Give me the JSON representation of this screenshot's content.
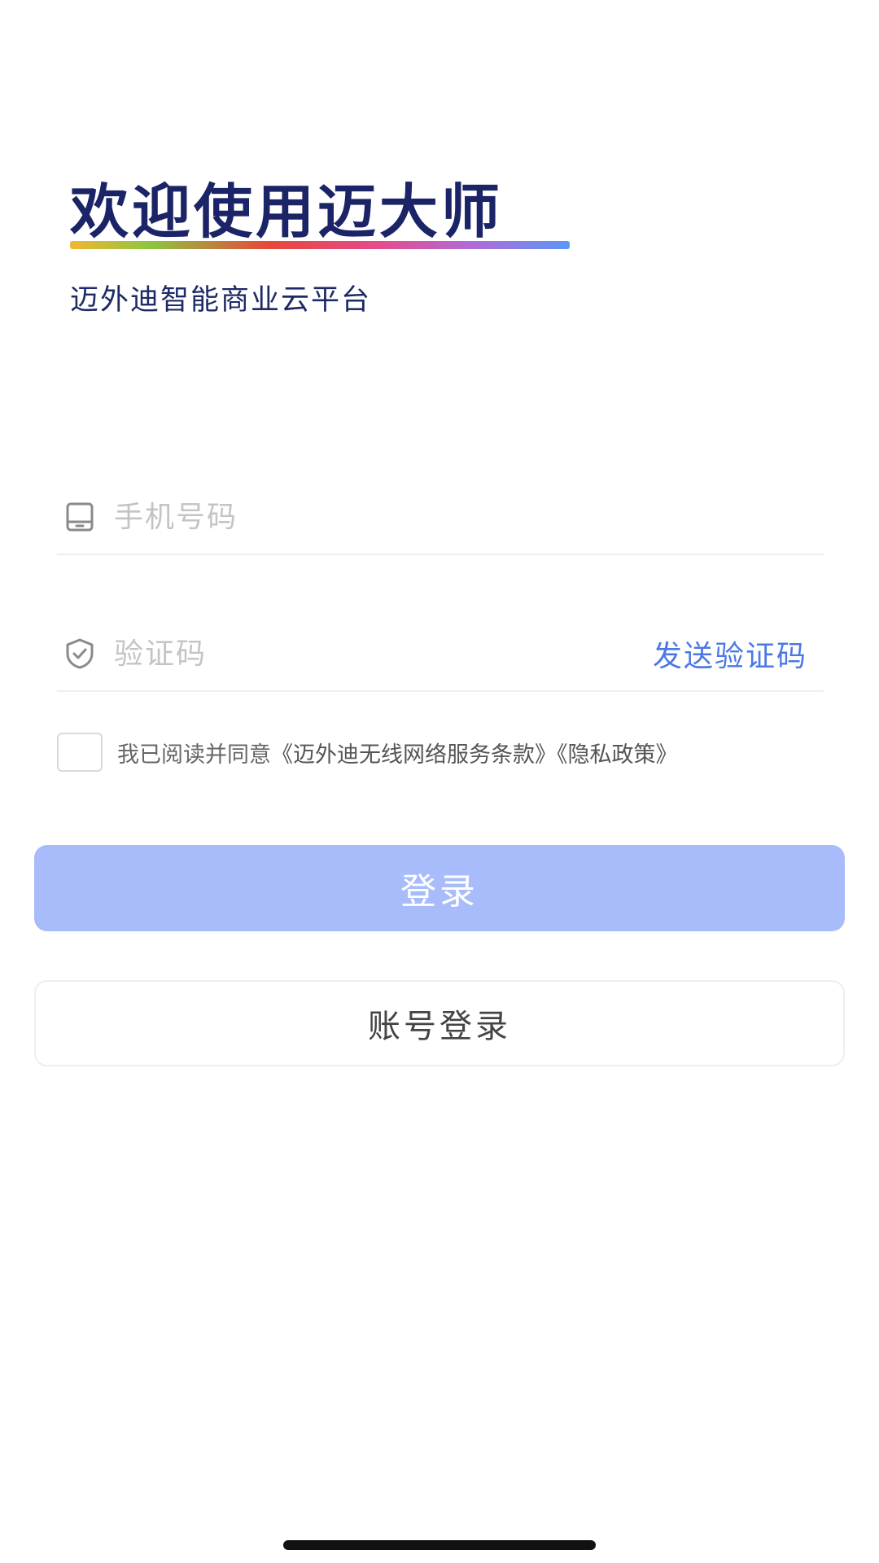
{
  "header": {
    "title": "欢迎使用迈大师",
    "subtitle": "迈外迪智能商业云平台"
  },
  "form": {
    "phone": {
      "icon": "tablet-icon",
      "placeholder": "手机号码",
      "value": ""
    },
    "code": {
      "icon": "shield-check-icon",
      "placeholder": "验证码",
      "value": "",
      "send_label": "发送验证码"
    },
    "agreement": {
      "checked": false,
      "prefix": "我已阅读并同意",
      "terms_link": "《迈外迪无线网络服务条款》",
      "privacy_link": "《隐私政策》"
    }
  },
  "buttons": {
    "login_label": "登录",
    "account_login_label": "账号登录"
  },
  "colors": {
    "title": "#1b2466",
    "accent": "#4c78e6",
    "login_button_disabled": "#a8bcfb"
  }
}
